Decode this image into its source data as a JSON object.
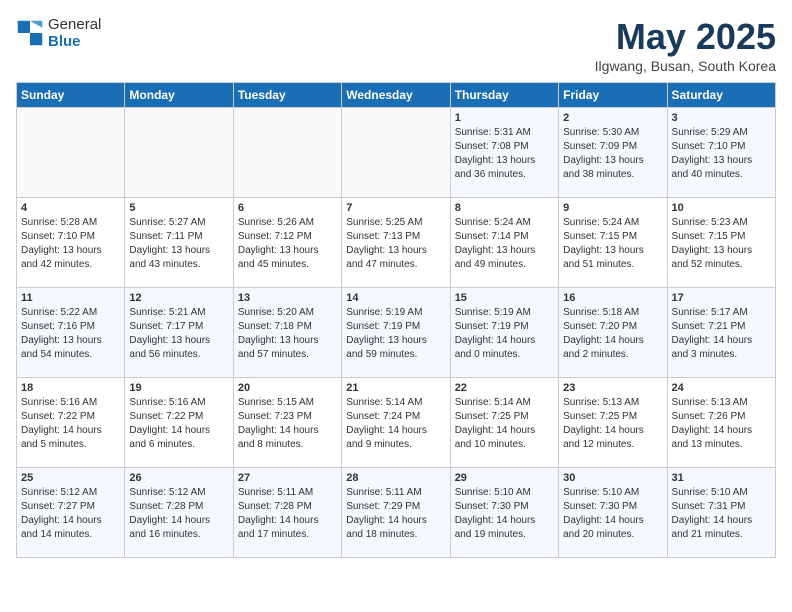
{
  "header": {
    "logo_general": "General",
    "logo_blue": "Blue",
    "title": "May 2025",
    "location": "Ilgwang, Busan, South Korea"
  },
  "weekdays": [
    "Sunday",
    "Monday",
    "Tuesday",
    "Wednesday",
    "Thursday",
    "Friday",
    "Saturday"
  ],
  "weeks": [
    [
      {
        "day": "",
        "info": ""
      },
      {
        "day": "",
        "info": ""
      },
      {
        "day": "",
        "info": ""
      },
      {
        "day": "",
        "info": ""
      },
      {
        "day": "1",
        "info": "Sunrise: 5:31 AM\nSunset: 7:08 PM\nDaylight: 13 hours\nand 36 minutes."
      },
      {
        "day": "2",
        "info": "Sunrise: 5:30 AM\nSunset: 7:09 PM\nDaylight: 13 hours\nand 38 minutes."
      },
      {
        "day": "3",
        "info": "Sunrise: 5:29 AM\nSunset: 7:10 PM\nDaylight: 13 hours\nand 40 minutes."
      }
    ],
    [
      {
        "day": "4",
        "info": "Sunrise: 5:28 AM\nSunset: 7:10 PM\nDaylight: 13 hours\nand 42 minutes."
      },
      {
        "day": "5",
        "info": "Sunrise: 5:27 AM\nSunset: 7:11 PM\nDaylight: 13 hours\nand 43 minutes."
      },
      {
        "day": "6",
        "info": "Sunrise: 5:26 AM\nSunset: 7:12 PM\nDaylight: 13 hours\nand 45 minutes."
      },
      {
        "day": "7",
        "info": "Sunrise: 5:25 AM\nSunset: 7:13 PM\nDaylight: 13 hours\nand 47 minutes."
      },
      {
        "day": "8",
        "info": "Sunrise: 5:24 AM\nSunset: 7:14 PM\nDaylight: 13 hours\nand 49 minutes."
      },
      {
        "day": "9",
        "info": "Sunrise: 5:24 AM\nSunset: 7:15 PM\nDaylight: 13 hours\nand 51 minutes."
      },
      {
        "day": "10",
        "info": "Sunrise: 5:23 AM\nSunset: 7:15 PM\nDaylight: 13 hours\nand 52 minutes."
      }
    ],
    [
      {
        "day": "11",
        "info": "Sunrise: 5:22 AM\nSunset: 7:16 PM\nDaylight: 13 hours\nand 54 minutes."
      },
      {
        "day": "12",
        "info": "Sunrise: 5:21 AM\nSunset: 7:17 PM\nDaylight: 13 hours\nand 56 minutes."
      },
      {
        "day": "13",
        "info": "Sunrise: 5:20 AM\nSunset: 7:18 PM\nDaylight: 13 hours\nand 57 minutes."
      },
      {
        "day": "14",
        "info": "Sunrise: 5:19 AM\nSunset: 7:19 PM\nDaylight: 13 hours\nand 59 minutes."
      },
      {
        "day": "15",
        "info": "Sunrise: 5:19 AM\nSunset: 7:19 PM\nDaylight: 14 hours\nand 0 minutes."
      },
      {
        "day": "16",
        "info": "Sunrise: 5:18 AM\nSunset: 7:20 PM\nDaylight: 14 hours\nand 2 minutes."
      },
      {
        "day": "17",
        "info": "Sunrise: 5:17 AM\nSunset: 7:21 PM\nDaylight: 14 hours\nand 3 minutes."
      }
    ],
    [
      {
        "day": "18",
        "info": "Sunrise: 5:16 AM\nSunset: 7:22 PM\nDaylight: 14 hours\nand 5 minutes."
      },
      {
        "day": "19",
        "info": "Sunrise: 5:16 AM\nSunset: 7:22 PM\nDaylight: 14 hours\nand 6 minutes."
      },
      {
        "day": "20",
        "info": "Sunrise: 5:15 AM\nSunset: 7:23 PM\nDaylight: 14 hours\nand 8 minutes."
      },
      {
        "day": "21",
        "info": "Sunrise: 5:14 AM\nSunset: 7:24 PM\nDaylight: 14 hours\nand 9 minutes."
      },
      {
        "day": "22",
        "info": "Sunrise: 5:14 AM\nSunset: 7:25 PM\nDaylight: 14 hours\nand 10 minutes."
      },
      {
        "day": "23",
        "info": "Sunrise: 5:13 AM\nSunset: 7:25 PM\nDaylight: 14 hours\nand 12 minutes."
      },
      {
        "day": "24",
        "info": "Sunrise: 5:13 AM\nSunset: 7:26 PM\nDaylight: 14 hours\nand 13 minutes."
      }
    ],
    [
      {
        "day": "25",
        "info": "Sunrise: 5:12 AM\nSunset: 7:27 PM\nDaylight: 14 hours\nand 14 minutes."
      },
      {
        "day": "26",
        "info": "Sunrise: 5:12 AM\nSunset: 7:28 PM\nDaylight: 14 hours\nand 16 minutes."
      },
      {
        "day": "27",
        "info": "Sunrise: 5:11 AM\nSunset: 7:28 PM\nDaylight: 14 hours\nand 17 minutes."
      },
      {
        "day": "28",
        "info": "Sunrise: 5:11 AM\nSunset: 7:29 PM\nDaylight: 14 hours\nand 18 minutes."
      },
      {
        "day": "29",
        "info": "Sunrise: 5:10 AM\nSunset: 7:30 PM\nDaylight: 14 hours\nand 19 minutes."
      },
      {
        "day": "30",
        "info": "Sunrise: 5:10 AM\nSunset: 7:30 PM\nDaylight: 14 hours\nand 20 minutes."
      },
      {
        "day": "31",
        "info": "Sunrise: 5:10 AM\nSunset: 7:31 PM\nDaylight: 14 hours\nand 21 minutes."
      }
    ]
  ]
}
